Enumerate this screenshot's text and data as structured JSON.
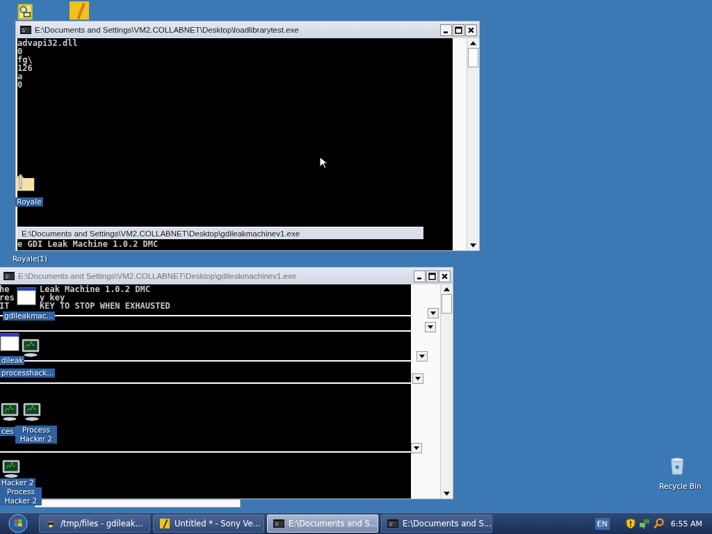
{
  "windows": [
    {
      "title": "E:\\Documents and Settings\\VM2.COLLABNET\\Desktop\\loadlibrarytest.exe",
      "active": true,
      "console_lines": [
        [
          "advapi32.dll"
        ],
        [
          "0"
        ],
        [
          "fg\\"
        ],
        [
          "126"
        ],
        [
          "a"
        ],
        [
          "0"
        ]
      ],
      "inner_title": "E:\\Documents and Settings\\VM2.COLLABNET\\Desktop\\gdileakmachinev1.exe",
      "inner_console_line": "e GDI Leak Machine 1.0.2 DMC"
    },
    {
      "title": "E:\\Documents and Settings\\VM2.COLLABNET\\Desktop\\gdileakmachinev1.exe",
      "active": false,
      "console_lines": [
        [
          "he",
          "Leak Machine 1.0.2 DMC"
        ],
        [
          "res",
          "y key"
        ],
        [
          "IT",
          "KEY TO STOP WHEN EXHAUSTED"
        ]
      ]
    }
  ],
  "desktop_icons": [
    {
      "kind": "clock-doc"
    },
    {
      "kind": "pencil"
    },
    {
      "kind": "zip",
      "label": "Royale"
    },
    {
      "kind": "none",
      "label": "Royale(1)"
    },
    {
      "kind": "window",
      "label": "gdileakmac..."
    },
    {
      "kind": "window",
      "label": "dileak"
    },
    {
      "kind": "monitor",
      "label": "processhack..."
    },
    {
      "kind": "monitor",
      "label": "ces"
    },
    {
      "kind": "monitor",
      "label": "Process Hacker 2"
    },
    {
      "kind": "monitor",
      "label": "Hacker 2"
    },
    {
      "kind": "none",
      "label": "Process Hacker 2"
    },
    {
      "kind": "bin",
      "label": "Recycle Bin"
    }
  ],
  "taskbar": {
    "tasks": [
      {
        "label": "/tmp/files - gdileak...",
        "selected": false
      },
      {
        "label": "Untitled * - Sony Ve...",
        "selected": false
      },
      {
        "label": "E:\\Documents and S...",
        "selected": true
      },
      {
        "label": "E:\\Documents and S...",
        "selected": false
      }
    ],
    "language": "EN",
    "clock": "6:55 AM"
  }
}
